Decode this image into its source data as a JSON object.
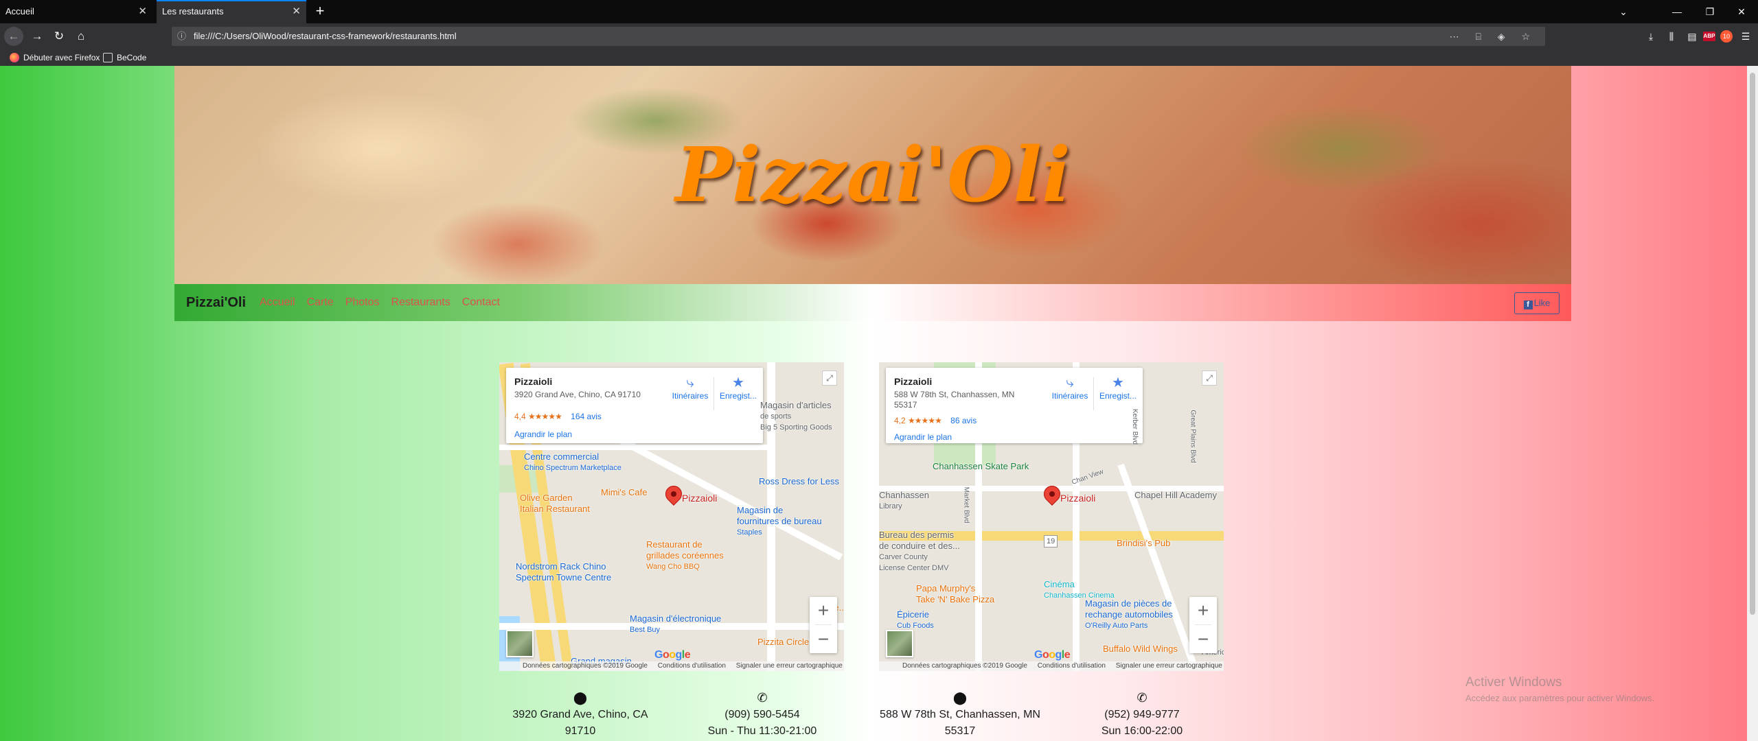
{
  "browser": {
    "tabs": [
      {
        "title": "Accueil",
        "active": false
      },
      {
        "title": "Les restaurants",
        "active": true
      }
    ],
    "url": "file:///C:/Users/OliWood/restaurant-css-framework/restaurants.html",
    "bookmarks": [
      "Débuter avec Firefox",
      "BeCode"
    ],
    "icons": {
      "info": "ⓘ",
      "back": "←",
      "forward": "→",
      "reload": "↻",
      "home": "⌂",
      "close": "✕",
      "new_tab": "+",
      "tab_list": "⌄",
      "minimize": "—",
      "restore": "❐",
      "page_actions": "⋯ ⌸ ◈ ☆",
      "downloads": "⤓",
      "library": "⫼",
      "sidebar": "▤",
      "addon1": "ABP",
      "addon2": "10",
      "menu": "☰"
    }
  },
  "hero": {
    "title": "Pizzai'Oli"
  },
  "navbar": {
    "brand": "Pizzai'Oli",
    "links": [
      "Accueil",
      "Carte",
      "Photos",
      "Restaurants",
      "Contact"
    ],
    "fb": {
      "icon": "f",
      "label": "Like"
    }
  },
  "maps": [
    {
      "name": "Pizzaioli",
      "address": "3920 Grand Ave, Chino, CA 91710",
      "rating": "4,4",
      "stars": "★★★★★",
      "reviews": "164 avis",
      "enlarge": "Agrandir le plan",
      "directions": "Itinéraires",
      "save": "Enregist...",
      "pin_label": "Pizzaioli",
      "pois": {
        "sporting_a": "Magasin d'articles",
        "sporting_b": "de sports",
        "sporting_c": "Big 5 Sporting Goods",
        "commercial": "Centre commercial",
        "commercial_sub": "Chino Spectrum Marketplace",
        "olive_a": "Olive Garden",
        "olive_b": "Italian Restaurant",
        "mimis": "Mimi's Cafe",
        "ross": "Ross Dress for Less",
        "staples_a": "Magasin de",
        "staples_b": "fournitures de bureau",
        "staples_c": "Staples",
        "wang_a": "Restaurant de",
        "wang_b": "grillades coréennes",
        "wang_c": "Wang Cho BBQ",
        "nordstrom_a": "Nordstrom Rack Chino",
        "nordstrom_b": "Spectrum Towne Centre",
        "bestbuy": "Magasin d'électronique",
        "bestbuy_sub": "Best Buy",
        "pizzitas": "Pizzita Circle",
        "grand": "Grand magasin",
        "edge": "Re..."
      },
      "footer": [
        "Données cartographiques ©2019 Google",
        "Conditions d'utilisation",
        "Signaler une erreur cartographique"
      ],
      "info": {
        "address": "3920 Grand Ave, Chino, CA 91710",
        "phone": "(909) 590-5454",
        "hours": "Sun - Thu 11:30-21:00"
      }
    },
    {
      "name": "Pizzaioli",
      "address": "588 W 78th St, Chanhassen, MN 55317",
      "rating": "4,2",
      "stars": "★★★★★",
      "reviews": "86 avis",
      "enlarge": "Agrandir le plan",
      "directions": "Itinéraires",
      "save": "Enregist...",
      "pin_label": "Pizzaioli",
      "pois": {
        "skate": "Chanhassen Skate Park",
        "library_a": "Chanhassen",
        "library_b": "Library",
        "chapel": "Chapel Hill Academy",
        "permits_a": "Bureau des permis",
        "permits_b": "de conduire et des...",
        "permits_c": "Carver County",
        "permits_d": "License Center DMV",
        "brindisi": "Brindisi's Pub",
        "cinema": "Cinéma",
        "cinema_sub": "Chanhassen Cinema",
        "papa_a": "Papa Murphy's",
        "papa_b": "Take 'N' Bake Pizza",
        "epicerie": "Épicerie",
        "epicerie_sub": "Cub Foods",
        "parts_a": "Magasin de pièces de",
        "parts_b": "rechange automobiles",
        "parts_c": "O'Reilly Auto Parts",
        "buffalo": "Buffalo Wild Wings",
        "road_19": "19",
        "america": "America...",
        "chan_view": "Chan View",
        "market": "Market Blvd",
        "great_plains": "Great Plains Blvd",
        "kerber": "Kerber Blvd"
      },
      "footer": [
        "Données cartographiques ©2019 Google",
        "Conditions d'utilisation",
        "Signaler une erreur cartographique"
      ],
      "info": {
        "address": "588 W 78th St, Chanhassen, MN 55317",
        "phone": "(952) 949-9777",
        "hours": "Sun 16:00-22:00"
      }
    }
  ],
  "map_controls": {
    "zoom_in": "+",
    "zoom_out": "−",
    "fullscreen": "⤢",
    "google": [
      "G",
      "o",
      "o",
      "g",
      "l",
      "e"
    ],
    "location_icon": "⬤",
    "phone_icon": "✆"
  },
  "watermark": {
    "title": "Activer Windows",
    "subtitle": "Accédez aux paramètres pour activer Windows."
  }
}
